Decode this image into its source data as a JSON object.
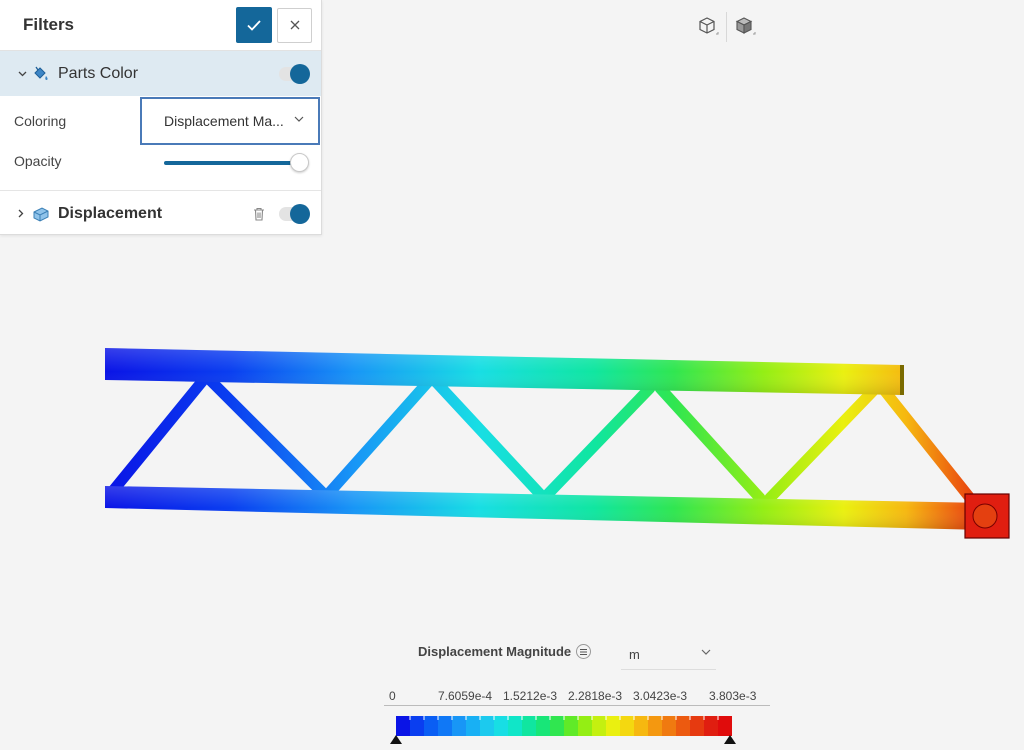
{
  "panel": {
    "title": "Filters",
    "apply_icon": "checkmark-icon",
    "close_icon": "close-icon",
    "parts_color": {
      "label": "Parts Color",
      "icon": "paint-bucket-icon",
      "enabled": true,
      "coloring_label": "Coloring",
      "coloring_value": "Displacement Ma...",
      "opacity_label": "Opacity",
      "opacity_value": 1.0
    },
    "displacement": {
      "label": "Displacement",
      "icon": "displacement-icon",
      "enabled": true
    }
  },
  "view_icons": [
    "wireframe-cube-icon",
    "solid-cube-icon"
  ],
  "legend": {
    "title": "Displacement Magnitude",
    "unit": "m",
    "ticks": [
      "0",
      "7.6059e-4",
      "1.5212e-3",
      "2.2818e-3",
      "3.0423e-3",
      "3.803e-3"
    ],
    "colors": [
      "#0a14e6",
      "#0a3ef0",
      "#0a5ef4",
      "#1078f6",
      "#1896f6",
      "#18b0f4",
      "#1ccaee",
      "#18dee4",
      "#10e6c8",
      "#10e6a0",
      "#18e678",
      "#30e650",
      "#60ea28",
      "#94ee14",
      "#c4f010",
      "#eaf010",
      "#f4d810",
      "#f6b810",
      "#f49810",
      "#f07a10",
      "#ec5a10",
      "#e63a10",
      "#e01e10",
      "#e00c0c"
    ]
  },
  "colors": {
    "accent": "#14679a",
    "select_border": "#4a7ab8"
  }
}
